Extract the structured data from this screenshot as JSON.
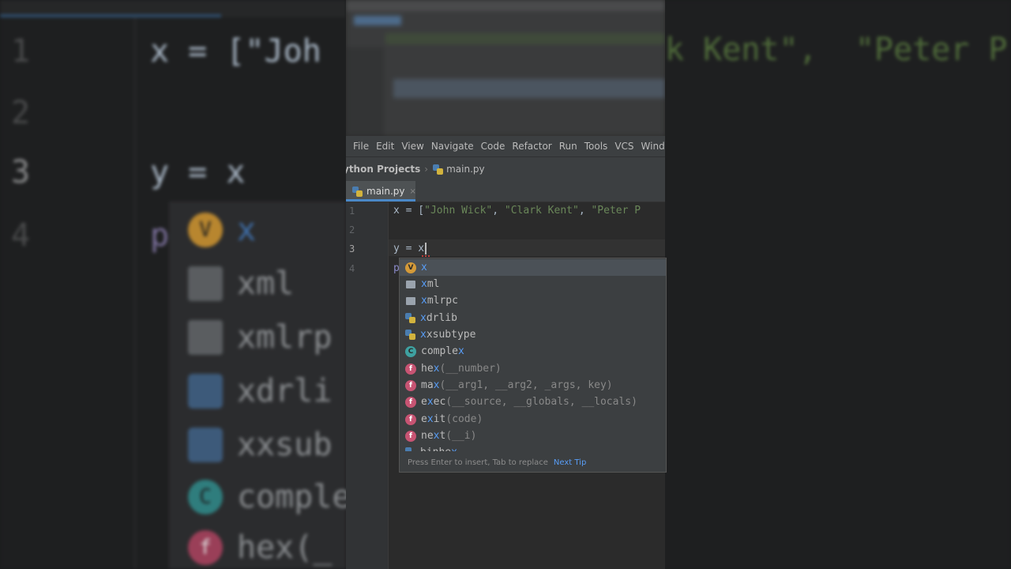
{
  "background_zoom": {
    "line_numbers": [
      "1",
      "2",
      "3",
      "4"
    ],
    "line1_prefix": "x = [\"Joh",
    "line3": "y = x",
    "line4_partial": "p",
    "right_fragment": "k Kent\",  \"Peter P",
    "items": [
      {
        "icon": "V",
        "text": "x"
      },
      {
        "icon": "",
        "text": "xml"
      },
      {
        "icon": "",
        "text": "xmlrp"
      },
      {
        "icon": "",
        "text": "xdrli"
      },
      {
        "icon": "",
        "text": "xxsub"
      },
      {
        "icon": "C",
        "text": "comple"
      },
      {
        "icon": "f",
        "text": "hex(_"
      }
    ]
  },
  "menu": [
    "File",
    "Edit",
    "View",
    "Navigate",
    "Code",
    "Refactor",
    "Run",
    "Tools",
    "VCS",
    "Wind"
  ],
  "breadcrumb": {
    "project": "ython Projects",
    "file": "main.py"
  },
  "tab": {
    "label": "main.py",
    "close": "×"
  },
  "editor": {
    "line_numbers": [
      "1",
      "2",
      "3",
      "4"
    ],
    "line1": {
      "prefix": "x = [",
      "s1": "\"John Wick\"",
      "sep1": ", ",
      "s2": "\"Clark Kent\"",
      "sep2": ", ",
      "s3": "\"Peter P"
    },
    "line3": "y = x",
    "line4": "p"
  },
  "completion": {
    "items": [
      {
        "icon": "V",
        "kind": "var",
        "match": "x",
        "rest": "",
        "sig": ""
      },
      {
        "icon": "",
        "kind": "pkg",
        "match": "x",
        "rest": "ml",
        "sig": ""
      },
      {
        "icon": "",
        "kind": "pkg",
        "match": "x",
        "rest": "mlrpc",
        "sig": ""
      },
      {
        "icon": "",
        "kind": "mod",
        "match": "x",
        "rest": "drlib",
        "sig": ""
      },
      {
        "icon": "",
        "kind": "mod",
        "match": "x",
        "rest": "xsubtype",
        "sig": ""
      },
      {
        "icon": "C",
        "kind": "cls",
        "pre": "comple",
        "match": "x",
        "sig": ""
      },
      {
        "icon": "f",
        "kind": "fn",
        "pre": "he",
        "match": "x",
        "sig": "(__number)"
      },
      {
        "icon": "f",
        "kind": "fn",
        "pre": "ma",
        "match": "x",
        "sig": "(__arg1, __arg2, _args, key)"
      },
      {
        "icon": "f",
        "kind": "fn",
        "pre": "e",
        "match": "x",
        "rest": "ec",
        "sig": "(__source, __globals, __locals)"
      },
      {
        "icon": "f",
        "kind": "fn",
        "pre": "e",
        "match": "x",
        "rest": "it",
        "sig": "(code)"
      },
      {
        "icon": "f",
        "kind": "fn",
        "pre": "ne",
        "match": "x",
        "rest": "t",
        "sig": "(__i)"
      },
      {
        "icon": "",
        "kind": "mod",
        "pre": "binhe",
        "match": "x",
        "sig": ""
      }
    ],
    "footer_hint": "Press Enter to insert, Tab to replace",
    "footer_link": "Next Tip"
  }
}
